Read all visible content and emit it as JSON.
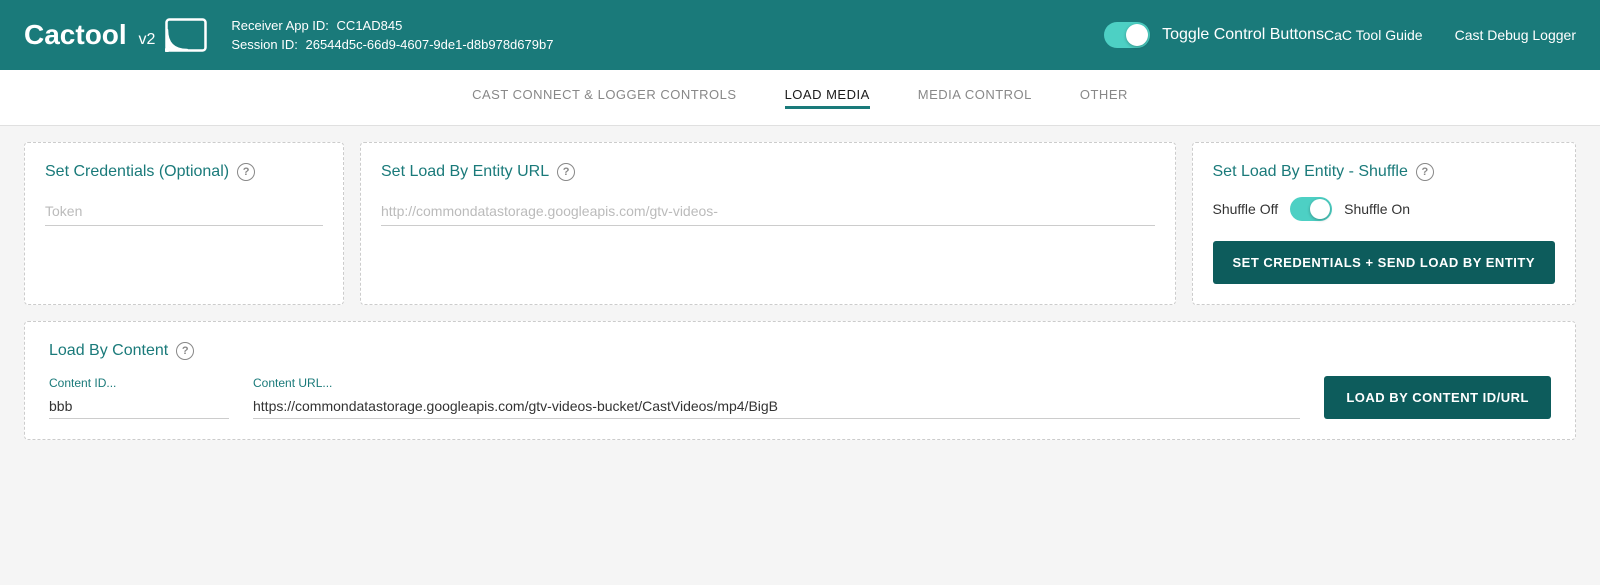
{
  "header": {
    "logo_text": "Cactool",
    "logo_version": "v2",
    "receiver_app_label": "Receiver App ID:",
    "receiver_app_id": "CC1AD845",
    "session_label": "Session ID:",
    "session_id": "26544d5c-66d9-4607-9de1-d8b978d679b7",
    "toggle_label": "Toggle Control Buttons",
    "nav_links": [
      {
        "label": "CaC Tool Guide"
      },
      {
        "label": "Cast Debug Logger"
      }
    ]
  },
  "tabs": [
    {
      "label": "CAST CONNECT & LOGGER CONTROLS",
      "active": false
    },
    {
      "label": "LOAD MEDIA",
      "active": true
    },
    {
      "label": "MEDIA CONTROL",
      "active": false
    },
    {
      "label": "OTHER",
      "active": false
    }
  ],
  "cards_row": {
    "credentials": {
      "title": "Set Credentials (Optional)",
      "token_placeholder": "Token"
    },
    "entity_url": {
      "title": "Set Load By Entity URL",
      "url_placeholder": "http://commondatastorage.googleapis.com/gtv-videos-"
    },
    "shuffle": {
      "title": "Set Load By Entity - Shuffle",
      "shuffle_off": "Shuffle Off",
      "shuffle_on": "Shuffle On",
      "button_label": "SET CREDENTIALS + SEND LOAD BY ENTITY"
    }
  },
  "load_by_content": {
    "title": "Load By Content",
    "content_id_label": "Content ID...",
    "content_id_value": "bbb",
    "content_url_label": "Content URL...",
    "content_url_value": "https://commondatastorage.googleapis.com/gtv-videos-bucket/CastVideos/mp4/BigB",
    "button_label": "LOAD BY CONTENT ID/URL"
  }
}
